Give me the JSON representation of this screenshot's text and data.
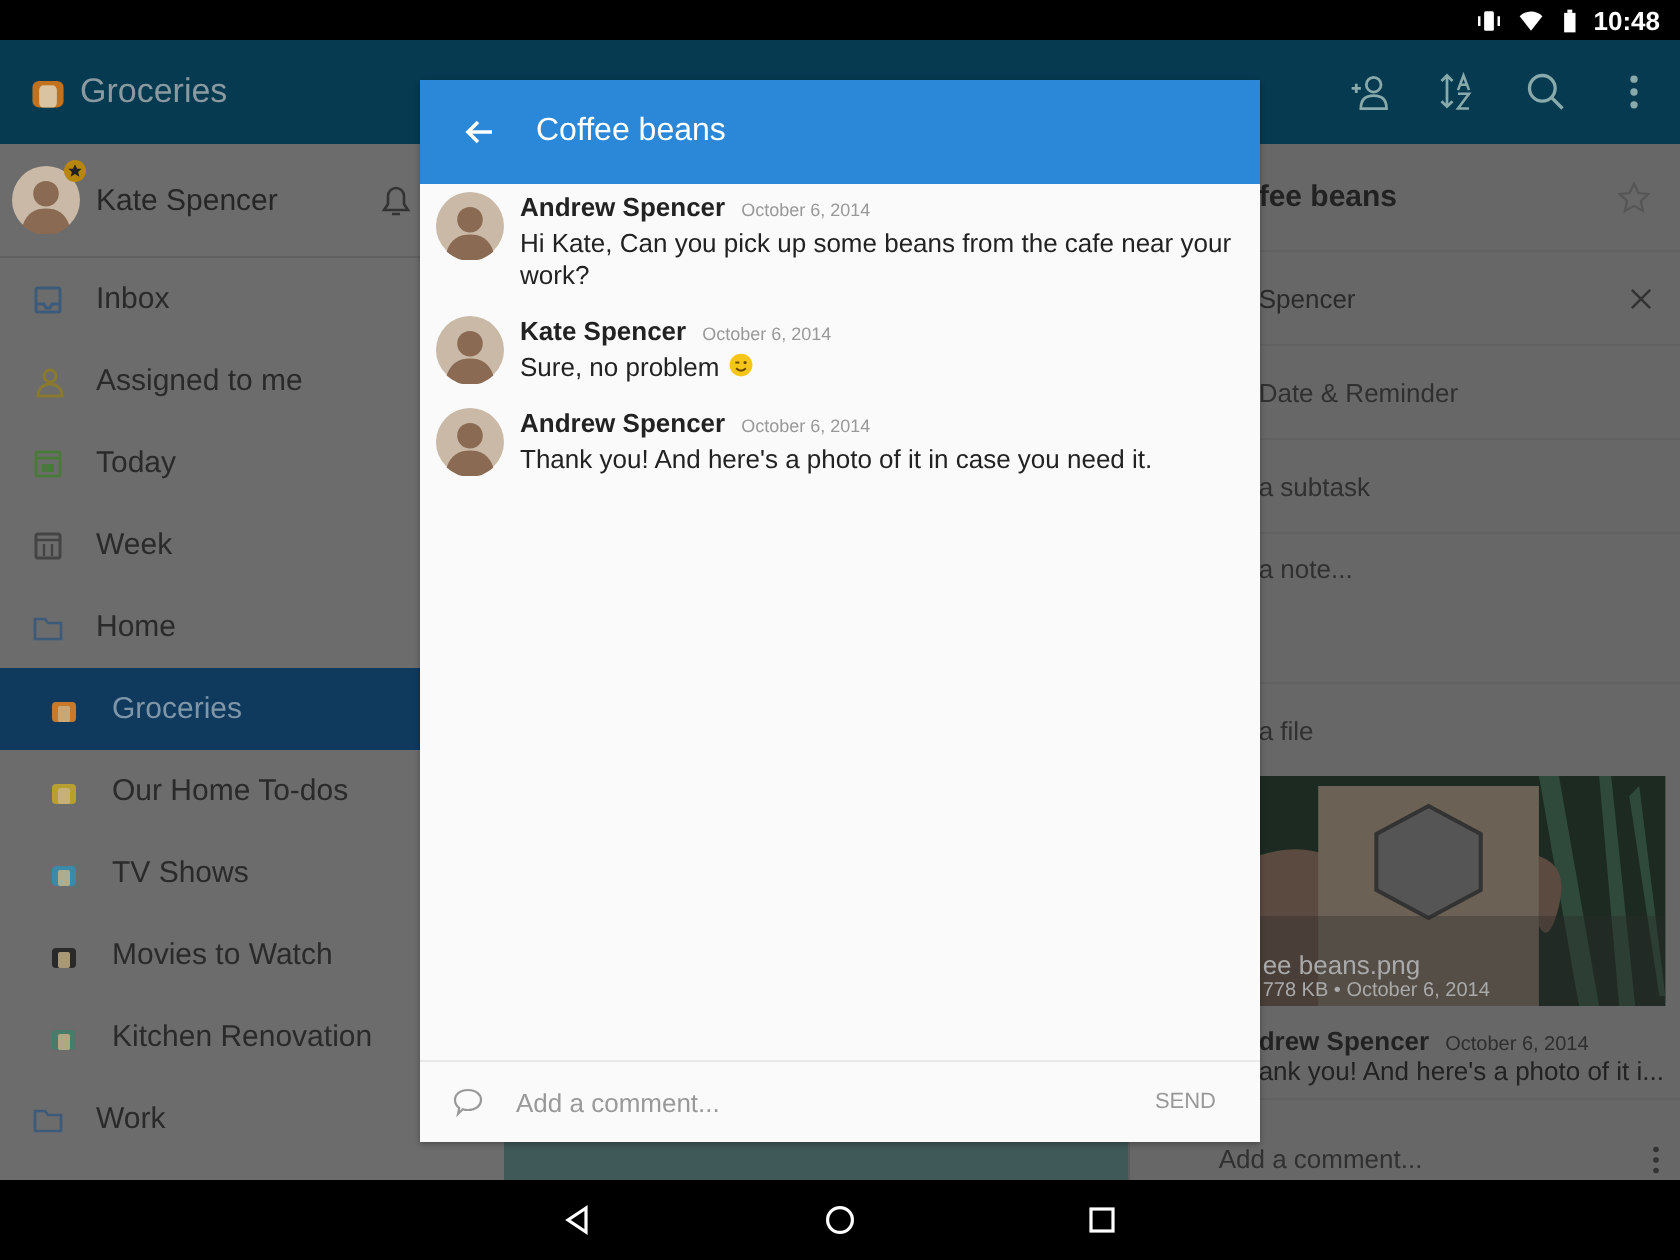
{
  "status_bar": {
    "time": "10:48"
  },
  "app_bar": {
    "title": "Groceries"
  },
  "sidebar": {
    "user": {
      "name": "Kate Spencer"
    },
    "items": [
      {
        "label": "Inbox",
        "kind": "inbox",
        "selected": false
      },
      {
        "label": "Assigned to me",
        "kind": "assigned",
        "selected": false
      },
      {
        "label": "Today",
        "kind": "today",
        "selected": false
      },
      {
        "label": "Week",
        "kind": "week",
        "selected": false
      },
      {
        "label": "Home",
        "kind": "folder",
        "selected": false,
        "children": [
          {
            "label": "Groceries",
            "kind": "list",
            "selected": true
          },
          {
            "label": "Our Home To-dos",
            "kind": "list",
            "selected": false
          },
          {
            "label": "TV Shows",
            "kind": "list",
            "selected": false
          },
          {
            "label": "Movies to Watch",
            "kind": "list",
            "selected": false
          },
          {
            "label": "Kitchen Renovation",
            "kind": "list",
            "selected": false
          }
        ]
      },
      {
        "label": "Work",
        "kind": "folder",
        "selected": false
      }
    ]
  },
  "detail": {
    "title": "fee beans",
    "assignee": "Spencer",
    "due": "Date & Reminder",
    "subtask": "a subtask",
    "note": "a note...",
    "file": "a file",
    "attachment": {
      "kind": "picture",
      "name": "ee beans.png",
      "meta": "778 KB • October 6, 2014"
    },
    "last_comment": {
      "author": "drew Spencer",
      "date": "October 6, 2014",
      "text": "ank you! And here's a photo of it i..."
    },
    "comment_placeholder": "Add a comment..."
  },
  "dialog": {
    "title": "Coffee beans",
    "messages": [
      {
        "author": "Andrew Spencer",
        "date": "October 6, 2014",
        "text": "Hi Kate, Can you pick up some beans from the cafe near your work?"
      },
      {
        "author": "Kate Spencer",
        "date": "October 6, 2014",
        "text": "Sure, no problem",
        "emoji": {
          "kind": "wink"
        }
      },
      {
        "author": "Andrew Spencer",
        "date": "October 6, 2014",
        "text": "Thank you! And here's a photo of it in case you need it."
      }
    ],
    "comment_placeholder": "Add a comment...",
    "send": "SEND"
  }
}
